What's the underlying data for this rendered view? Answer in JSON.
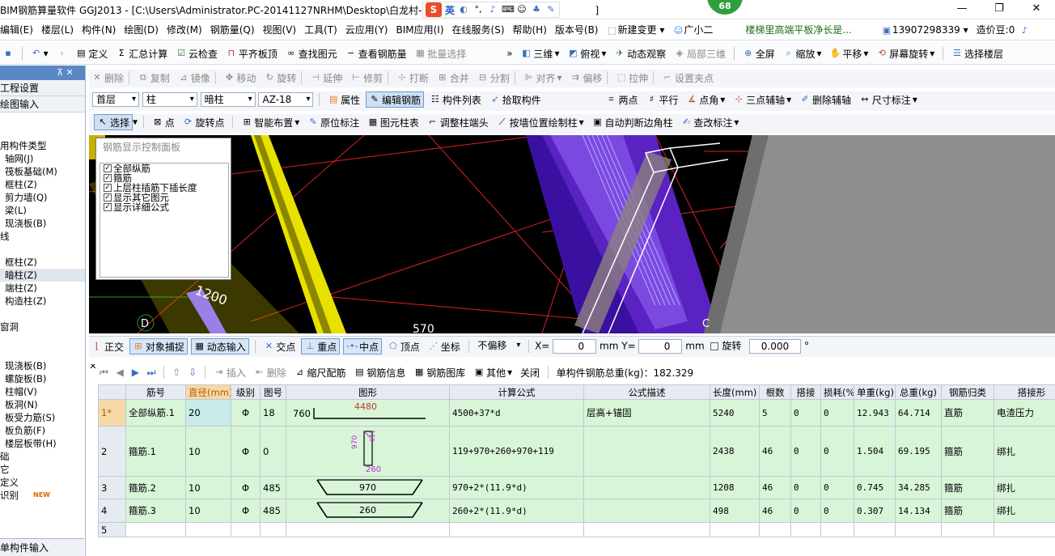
{
  "titlebar": {
    "title": "BIM钢筋算量软件 GGJ2013 - [C:\\Users\\Administrator.PC-20141127NRHM\\Desktop\\白龙村-",
    "title_suffix": "]",
    "ime": {
      "logo": "S",
      "mode": "英"
    },
    "badge": "68"
  },
  "menubar": [
    "编辑(E)",
    "楼层(L)",
    "构件(N)",
    "绘图(D)",
    "修改(M)",
    "钢筋量(Q)",
    "视图(V)",
    "工具(T)",
    "云应用(Y)",
    "BIM应用(I)",
    "在线服务(S)",
    "帮助(H)",
    "版本号(B)",
    "新建变更",
    "广小二",
    "楼梯里高端平板净长是...",
    "13907298339",
    "造价豆:0"
  ],
  "toolbar1": {
    "items": [
      "定义",
      "汇总计算",
      "云检查",
      "平齐板顶",
      "查找图元",
      "查看钢筋量",
      "批量选择",
      "三维",
      "俯视",
      "动态观察",
      "局部三维",
      "全屏",
      "缩放",
      "平移",
      "屏幕旋转",
      "选择楼层"
    ]
  },
  "leftpanel": {
    "header": "⊼ ✕",
    "nav": [
      "工程设置",
      "绘图输入"
    ],
    "tree": [
      "用构件类型",
      "轴网(J)",
      "筏板基础(M)",
      "框柱(Z)",
      "剪力墙(Q)",
      "梁(L)",
      "现浇板(B)",
      "线",
      "",
      "框柱(Z)",
      "暗柱(Z)",
      "端柱(Z)",
      "构造柱(Z)",
      "",
      "窗洞",
      "",
      "",
      "现浇板(B)",
      "螺旋板(B)",
      "柱帽(V)",
      "板洞(N)",
      "板受力筋(S)",
      "板负筋(F)",
      "楼层板带(H)",
      "础",
      "它",
      "定义",
      "识别"
    ],
    "new_badge": "NEW",
    "bottom": "单构件输入"
  },
  "toolbar2": [
    "删除",
    "复制",
    "镜像",
    "移动",
    "旋转",
    "延伸",
    "修剪",
    "打断",
    "合并",
    "分割",
    "对齐",
    "偏移",
    "拉伸",
    "设置夹点"
  ],
  "toolbar3": {
    "floor": "首层",
    "type": "柱",
    "subtype": "暗柱",
    "name": "AZ-18",
    "buttons": [
      "属性",
      "编辑钢筋",
      "构件列表",
      "拾取构件",
      "两点",
      "平行",
      "点角",
      "三点辅轴",
      "删除辅轴",
      "尺寸标注"
    ]
  },
  "toolbar4": [
    "选择",
    "点",
    "旋转点",
    "智能布置",
    "原位标注",
    "图元柱表",
    "调整柱端头",
    "按墙位置绘制柱",
    "自动判断边角柱",
    "查改标注"
  ],
  "rebar_panel": {
    "title": "钢筋显示控制面板",
    "items": [
      "全部纵筋",
      "箍筋",
      "上层柱插筋下插长度",
      "显示其它图元",
      "显示详细公式"
    ]
  },
  "viewport_labels": {
    "dim": "1200",
    "dim2": "570",
    "axis_d": "D",
    "axis_c": "C"
  },
  "snapbar": {
    "buttons": [
      "正交",
      "对象捕捉",
      "动态输入",
      "交点",
      "重点",
      "中点",
      "顶点",
      "坐标"
    ],
    "offset": "不偏移",
    "x_label": "X=",
    "x": "0",
    "mm": "mm",
    "y_label": "Y=",
    "y": "0",
    "mm2": "mm",
    "rotate": "旋转",
    "angle": "0.000",
    "deg": "°"
  },
  "rebar_toolbar": {
    "items": [
      "插入",
      "删除",
      "缩尺配筋",
      "钢筋信息",
      "钢筋图库",
      "其他",
      "关闭"
    ],
    "total": "单构件钢筋总重(kg)：182.329"
  },
  "table": {
    "headers": [
      "筋号",
      "直径(mm)",
      "级别",
      "图号",
      "图形",
      "计算公式",
      "公式描述",
      "长度(mm)",
      "根数",
      "搭接",
      "损耗(%)",
      "单重(kg)",
      "总重(kg)",
      "钢筋归类",
      "搭接形"
    ],
    "rows": [
      {
        "rn": "1*",
        "name": "全部纵筋.1",
        "dia": "20",
        "grade": "Φ",
        "fig": "18",
        "shape_a": "760",
        "shape_b": "4480",
        "formula": "4500+37*d",
        "desc": "层高+锚固",
        "len": "5240",
        "count": "5",
        "lap": "0",
        "loss": "0",
        "unit": "12.943",
        "total": "64.714",
        "cat": "直筋",
        "laptype": "电渣压力"
      },
      {
        "rn": "2",
        "name": "箍筋.1",
        "dia": "10",
        "grade": "Φ",
        "fig": "0",
        "shape_a": "970",
        "shape_b": "260",
        "shape_c": "119",
        "formula": "119+970+260+970+119",
        "desc": "",
        "len": "2438",
        "count": "46",
        "lap": "0",
        "loss": "0",
        "unit": "1.504",
        "total": "69.195",
        "cat": "箍筋",
        "laptype": "绑扎"
      },
      {
        "rn": "3",
        "name": "箍筋.2",
        "dia": "10",
        "grade": "Φ",
        "fig": "485",
        "shape_a": "970",
        "formula": "970+2*(11.9*d)",
        "desc": "",
        "len": "1208",
        "count": "46",
        "lap": "0",
        "loss": "0",
        "unit": "0.745",
        "total": "34.285",
        "cat": "箍筋",
        "laptype": "绑扎"
      },
      {
        "rn": "4",
        "name": "箍筋.3",
        "dia": "10",
        "grade": "Φ",
        "fig": "485",
        "shape_a": "260",
        "formula": "260+2*(11.9*d)",
        "desc": "",
        "len": "498",
        "count": "46",
        "lap": "0",
        "loss": "0",
        "unit": "0.307",
        "total": "14.134",
        "cat": "箍筋",
        "laptype": "绑扎"
      },
      {
        "rn": "5"
      }
    ]
  }
}
